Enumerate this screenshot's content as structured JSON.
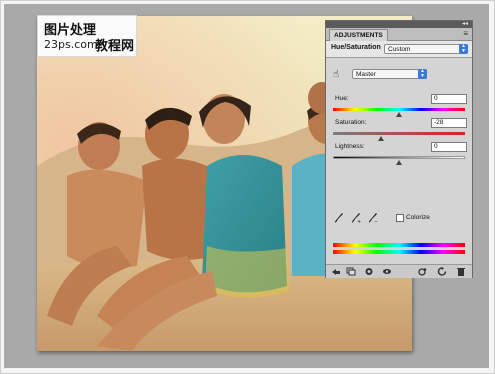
{
  "watermark": {
    "line1": "图片处理",
    "line2_domain": "23ps.com",
    "line2_cn": "教程网"
  },
  "adjustments_panel": {
    "tab_label": "ADJUSTMENTS",
    "title": "Hue/Saturation",
    "preset_value": "Custom",
    "channel_value": "Master",
    "hue": {
      "label": "Hue:",
      "value": "0",
      "level": 0.5
    },
    "saturation": {
      "label": "Saturation:",
      "value": "-28",
      "level": 0.36
    },
    "lightness": {
      "label": "Lightness:",
      "value": "0",
      "level": 0.5
    },
    "colorize_label": "Colorize",
    "colorize_checked": false
  },
  "icons": [
    "targeted-adjustment-hand-icon",
    "eyedropper-icon",
    "eyedropper-plus-icon",
    "eyedropper-minus-icon",
    "return-to-list-icon",
    "expanded-view-icon",
    "clip-to-layer-icon",
    "visibility-eye-icon",
    "previous-state-icon",
    "reset-icon",
    "delete-icon"
  ],
  "colors": {
    "canvas_gray": "#a9a9a9",
    "panel_bg": "#d4d4d4",
    "dropdown_accent": "#3b78d8"
  }
}
